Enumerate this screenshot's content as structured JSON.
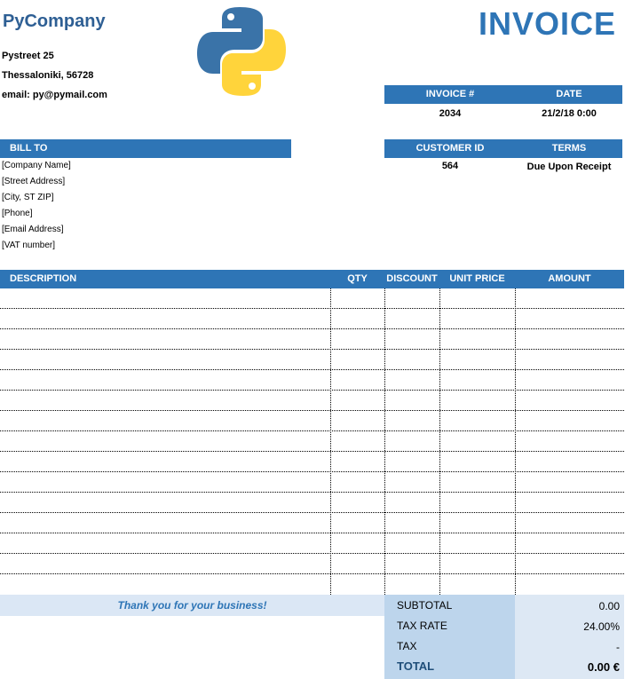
{
  "company": {
    "name": "PyCompany",
    "street": "Pystreet 25",
    "city": "Thessaloniki, 56728",
    "email": "email: py@pymail.com"
  },
  "document_title": "INVOICE",
  "invoice_meta": {
    "invoice_label": "INVOICE #",
    "date_label": "DATE",
    "invoice_number": "2034",
    "date": "21/2/18 0:00",
    "customer_id_label": "CUSTOMER ID",
    "terms_label": "TERMS",
    "customer_id": "564",
    "terms": "Due Upon Receipt"
  },
  "bill_to": {
    "label": "BILL TO",
    "lines": [
      "[Company Name]",
      "[Street Address]",
      "[City, ST ZIP]",
      "[Phone]",
      "[Email Address]",
      "[VAT number]"
    ]
  },
  "items_table": {
    "headers": {
      "description": "DESCRIPTION",
      "qty": "QTY",
      "discount": "DISCOUNT",
      "unit_price": "UNIT PRICE",
      "amount": "AMOUNT"
    },
    "rows": []
  },
  "footer": {
    "thanks": "Thank you for your business!"
  },
  "summary": {
    "subtotal_label": "SUBTOTAL",
    "subtotal": "0.00",
    "tax_rate_label": "TAX RATE",
    "tax_rate": "24.00%",
    "tax_label": "TAX",
    "tax": "-",
    "total_label": "TOTAL",
    "total": "0.00 €"
  },
  "colors": {
    "header_blue": "#2e75b6",
    "company_blue": "#2e5f94",
    "python_blue": "#3a73a8",
    "python_yellow": "#ffd43b"
  },
  "logo": {
    "icon": "python-logo-icon"
  }
}
